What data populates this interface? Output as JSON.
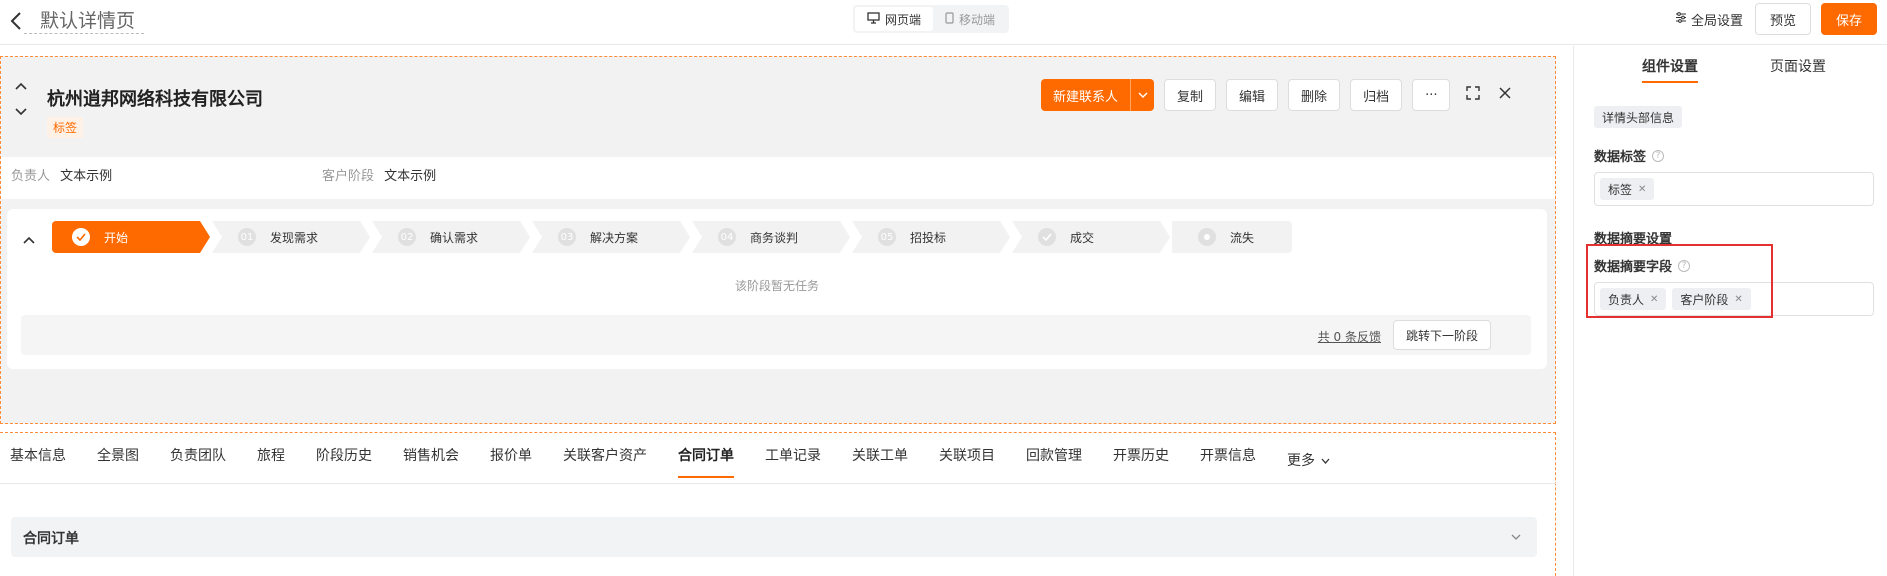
{
  "topbar": {
    "page_title": "默认详情页",
    "device_tabs": [
      {
        "label": "网页端",
        "active": true
      },
      {
        "label": "移动端",
        "active": false
      }
    ],
    "global_settings": "全局设置",
    "preview": "预览",
    "save": "保存"
  },
  "header": {
    "company": "杭州逍邦网络科技有限公司",
    "tag": "标签",
    "actions": {
      "new_contact": "新建联系人",
      "copy": "复制",
      "edit": "编辑",
      "delete": "删除",
      "archive": "归档",
      "more": "···"
    },
    "meta": [
      {
        "key": "负责人",
        "value": "文本示例"
      },
      {
        "key": "客户阶段",
        "value": "文本示例"
      }
    ]
  },
  "stages": [
    {
      "num": "",
      "label": "开始",
      "state": "active"
    },
    {
      "num": "01",
      "label": "发现需求"
    },
    {
      "num": "02",
      "label": "确认需求"
    },
    {
      "num": "03",
      "label": "解决方案"
    },
    {
      "num": "04",
      "label": "商务谈判"
    },
    {
      "num": "05",
      "label": "招投标"
    },
    {
      "num": "",
      "label": "成交"
    },
    {
      "num": "",
      "label": "流失"
    }
  ],
  "stage_panel": {
    "empty": "该阶段暂无任务",
    "feedback": "共 0 条反馈",
    "next": "跳转下一阶段"
  },
  "tabs": [
    "基本信息",
    "全景图",
    "负责团队",
    "旅程",
    "阶段历史",
    "销售机会",
    "报价单",
    "关联客户资产",
    "合同订单",
    "工单记录",
    "关联工单",
    "关联项目",
    "回款管理",
    "开票历史",
    "开票信息",
    "更多"
  ],
  "active_tab": "合同订单",
  "section": {
    "title": "合同订单"
  },
  "panel": {
    "tabs": [
      "组件设置",
      "页面设置"
    ],
    "header_chip": "详情头部信息",
    "data_tag_title": "数据标签",
    "data_tag_chip": "标签",
    "summary_settings": "数据摘要设置",
    "summary_field_title": "数据摘要字段",
    "summary_chips": [
      "负责人",
      "客户阶段"
    ]
  },
  "colors": {
    "accent": "#ff6a00",
    "highlight": "#e53030"
  }
}
